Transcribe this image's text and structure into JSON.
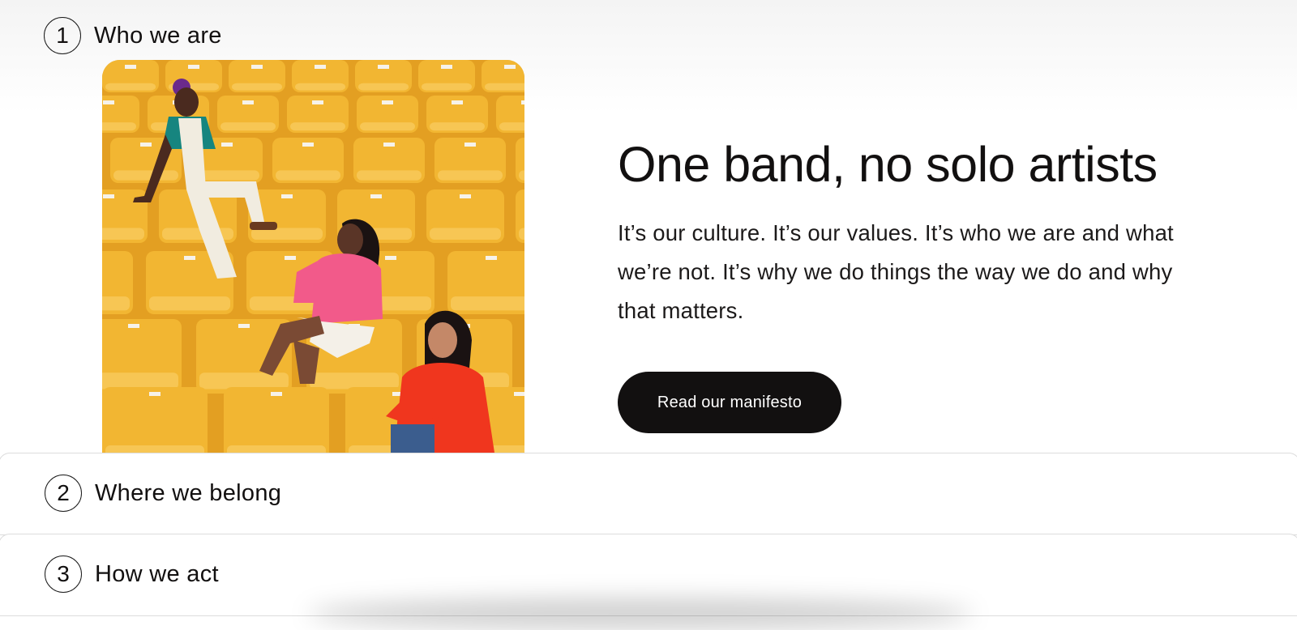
{
  "sections": [
    {
      "number": "1",
      "title": "Who we are"
    },
    {
      "number": "2",
      "title": "Where we belong"
    },
    {
      "number": "3",
      "title": "How we act"
    }
  ],
  "content": {
    "headline": "One band, no solo artists",
    "body": "It’s our culture. It’s our values. It’s who we are and what we’re not. It’s why we do things the way we do and why that matters.",
    "cta_label": "Read our manifesto"
  },
  "colors": {
    "seat_yellow": "#f2b632",
    "button_bg": "#121010",
    "text": "#121010"
  }
}
